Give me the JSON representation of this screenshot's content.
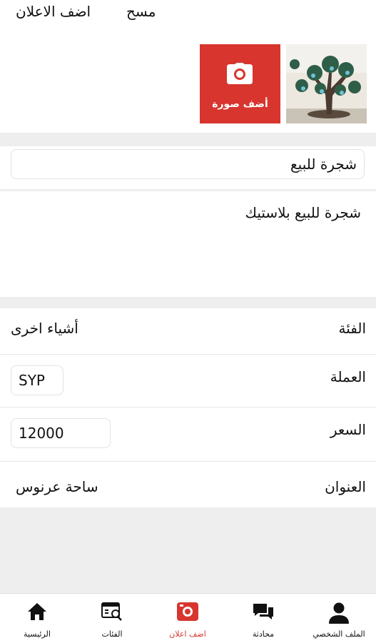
{
  "header": {
    "clear_label": "مسح",
    "post_label": "اضف الاعلان"
  },
  "photos": {
    "add_photo_label": "أضف صورة"
  },
  "ad": {
    "title": "شجرة للبيع",
    "description": "شجرة للبيع بلاستيك"
  },
  "details": {
    "category_label": "الفئة",
    "category_value": "أشياء اخرى",
    "currency_label": "العملة",
    "currency_value": "SYP",
    "price_label": "السعر",
    "price_value": "12000",
    "address_label": "العنوان",
    "address_value": "ساحة عرنوس"
  },
  "nav": {
    "items": [
      {
        "label": "الرئيسية",
        "icon": "home-icon"
      },
      {
        "label": "الفئات",
        "icon": "categories-icon"
      },
      {
        "label": "اضف اعلان",
        "icon": "camera-icon"
      },
      {
        "label": "محادثة",
        "icon": "chat-icon"
      },
      {
        "label": "الملف الشخصي",
        "icon": "profile-icon"
      }
    ]
  },
  "colors": {
    "accent": "#d7352e",
    "background": "#efeeee"
  }
}
